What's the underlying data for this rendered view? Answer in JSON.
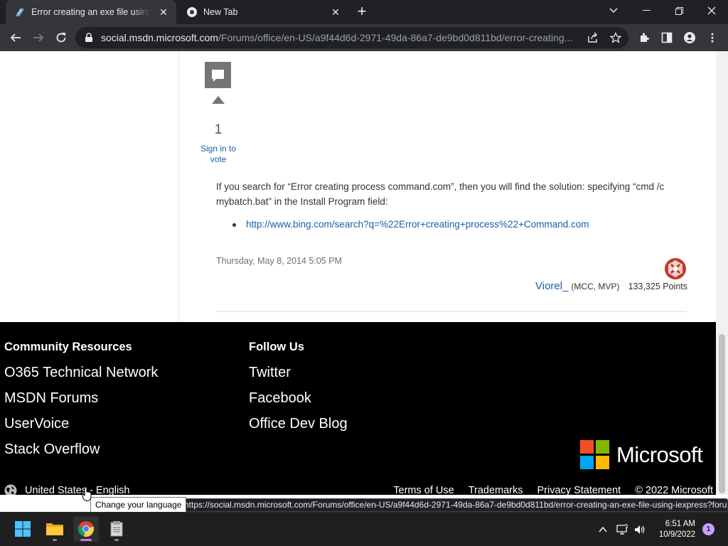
{
  "browser": {
    "tabs": [
      {
        "title": "Error creating an exe file using ie",
        "active": true
      },
      {
        "title": "New Tab",
        "active": false
      }
    ],
    "address": {
      "host": "social.msdn.microsoft.com",
      "path": "/Forums/office/en-US/a9f44d6d-2971-49da-86a7-de9bd0d811bd/error-creating..."
    },
    "status_url": "https://social.msdn.microsoft.com/Forums/office/en-US/a9f44d6d-2971-49da-86a7-de9bd0d811bd/error-creating-an-exe-file-using-iexpress?forum=windowssdk#"
  },
  "post": {
    "vote_count": "1",
    "sign_in_to_vote": "Sign in to vote",
    "body": "If you search for “Error creating process command.com”, then you will find the solution: specifying “cmd /c mybatch.bat” in the Install Program field:",
    "link": "http://www.bing.com/search?q=%22Error+creating+process%22+Command.com",
    "date": "Thursday, May 8, 2014 5:05 PM",
    "author": {
      "name": "Viorel_",
      "badge": "(MCC, MVP)",
      "points": "133,325 Points"
    }
  },
  "footer": {
    "community": {
      "heading": "Community Resources",
      "links": [
        "O365 Technical Network",
        "MSDN Forums",
        "UserVoice",
        "Stack Overflow"
      ]
    },
    "follow": {
      "heading": "Follow Us",
      "links": [
        "Twitter",
        "Facebook",
        "Office Dev Blog"
      ]
    },
    "brand": "Microsoft",
    "locale": "United States - English",
    "legal": [
      "Terms of Use",
      "Trademarks",
      "Privacy Statement",
      "© 2022 Microsoft"
    ]
  },
  "tooltip": "Change your language",
  "taskbar": {
    "time": "6:51 AM",
    "date": "10/9/2022",
    "notification_count": "1"
  },
  "colors": {
    "link": "#1d5da6",
    "chrome_dark": "#202124",
    "ms_red": "#f25022",
    "ms_green": "#7fba00",
    "ms_blue": "#00a4ef",
    "ms_yellow": "#ffb900"
  }
}
